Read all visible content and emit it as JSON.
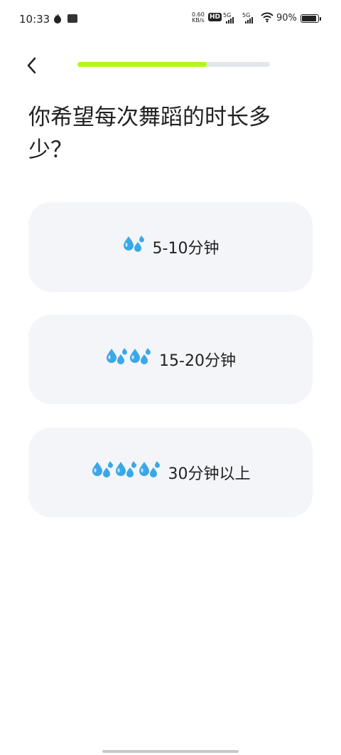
{
  "status_bar": {
    "time": "10:33",
    "net_speed_value": "0.60",
    "net_speed_unit": "KB/s",
    "hd_label": "HD",
    "sim1_label": "5G",
    "sim2_label": "5G",
    "battery_percent_text": "90%",
    "battery_level": 0.9
  },
  "header": {
    "back_icon": "chevron-left-icon",
    "progress": 0.67,
    "progress_color": "#b6f51c",
    "track_color": "#e3e6ec"
  },
  "question": "你希望每次舞蹈的时长多少？",
  "options": [
    {
      "label": "5-10分钟",
      "drop_count": 1
    },
    {
      "label": "15-20分钟",
      "drop_count": 2
    },
    {
      "label": "30分钟以上",
      "drop_count": 3
    }
  ],
  "colors": {
    "option_bg": "#f4f5f9",
    "drop_color": "#3aa8e8"
  }
}
